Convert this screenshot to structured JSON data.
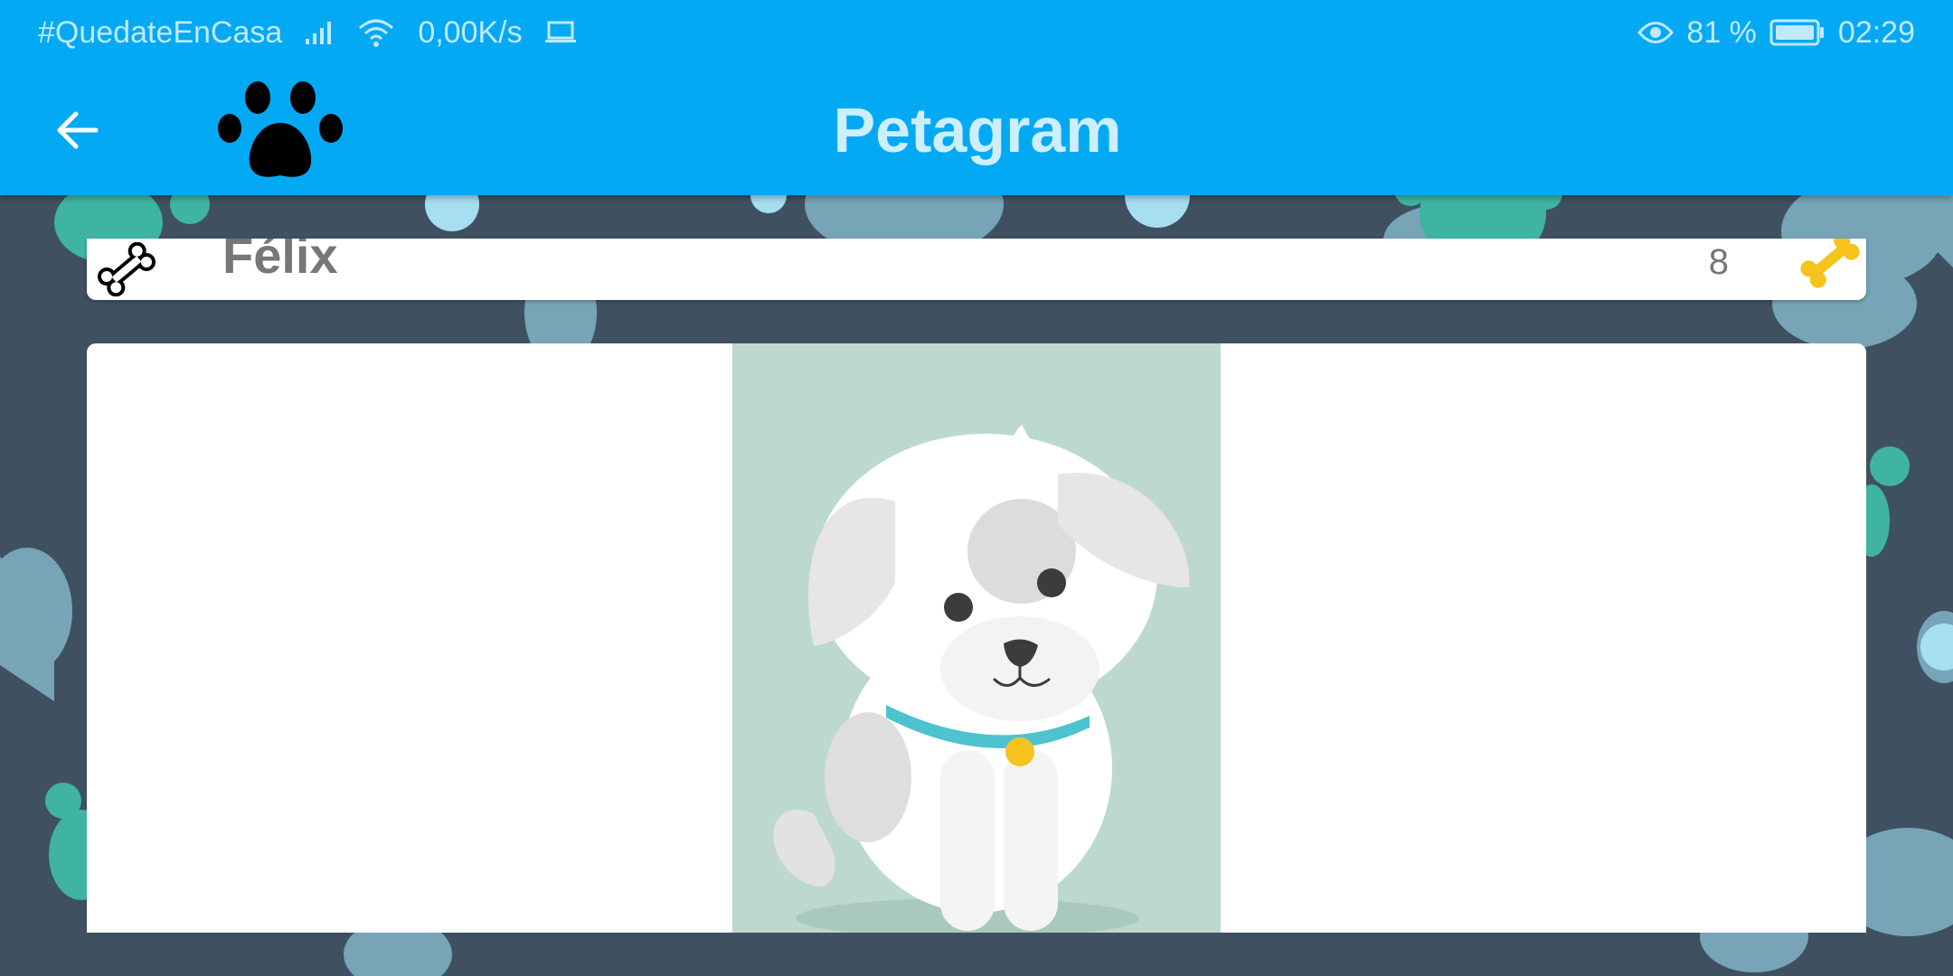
{
  "status_bar": {
    "hashtag": "#QuedateEnCasa",
    "net_speed": "0,00K/s",
    "battery_percent": "81 %",
    "time": "02:29",
    "icons": [
      "signal-icon",
      "wifi-icon",
      "laptop-icon",
      "eye-icon",
      "battery-icon"
    ]
  },
  "toolbar": {
    "title": "Petagram",
    "back_icon": "arrow-left-icon",
    "logo_icon": "paw-icon"
  },
  "pet": {
    "name": "Félix",
    "likes": "8",
    "rating_icon": "bone-icon",
    "like_icon": "gold-bone-icon"
  },
  "colors": {
    "primary": "#04a9f4",
    "title_text": "#cdeefc",
    "background": "#3f5161",
    "photo_background": "#bdd9cf",
    "collar": "#4cc3cf",
    "like_bone": "#f6c21c"
  }
}
